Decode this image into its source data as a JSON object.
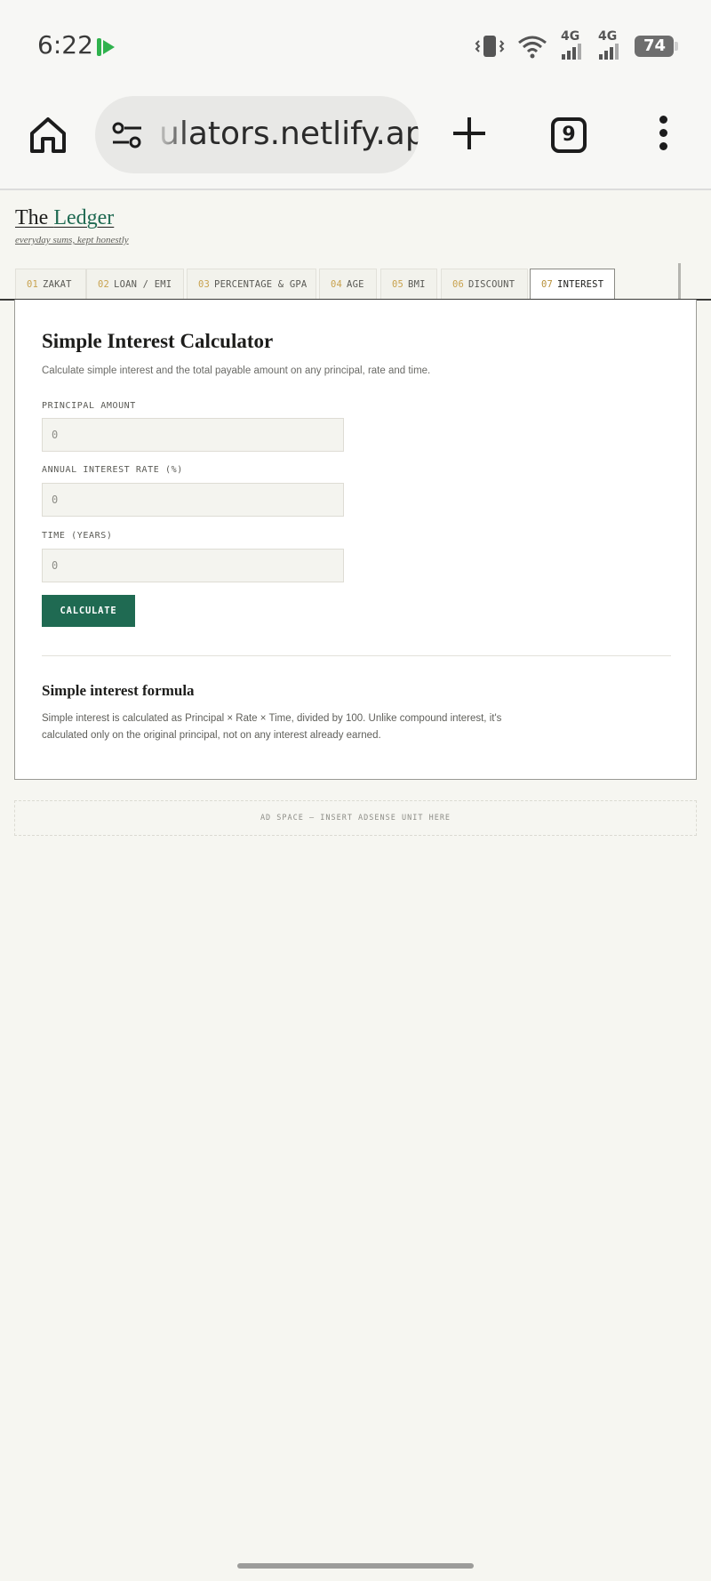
{
  "status": {
    "time": "6:22",
    "net1": "4G",
    "net2": "4G",
    "battery": "74"
  },
  "browser": {
    "url": "ulators.netlify.app",
    "tab_count": "9"
  },
  "site": {
    "brand_prefix": "The ",
    "brand_accent": "Ledger",
    "tagline": "everyday sums, kept honestly"
  },
  "tabs": [
    {
      "num": "01",
      "label": "ZAKAT"
    },
    {
      "num": "02",
      "label": "LOAN / EMI"
    },
    {
      "num": "03",
      "label": "PERCENTAGE & GPA"
    },
    {
      "num": "04",
      "label": "AGE"
    },
    {
      "num": "05",
      "label": "BMI"
    },
    {
      "num": "06",
      "label": "DISCOUNT"
    },
    {
      "num": "07",
      "label": "INTEREST"
    }
  ],
  "calculator": {
    "title": "Simple Interest Calculator",
    "description": "Calculate simple interest and the total payable amount on any principal, rate and time.",
    "principal_label": "PRINCIPAL AMOUNT",
    "principal_placeholder": "0",
    "rate_label": "ANNUAL INTEREST RATE (%)",
    "rate_placeholder": "0",
    "time_label": "TIME (YEARS)",
    "time_placeholder": "0",
    "button_label": "CALCULATE"
  },
  "formula": {
    "title": "Simple interest formula",
    "text": "Simple interest is calculated as Principal × Rate × Time, divided by 100. Unlike compound interest, it's calculated only on the original principal, not on any interest already earned."
  },
  "ad": {
    "text": "AD SPACE — INSERT ADSENSE UNIT HERE"
  },
  "colors": {
    "accent": "#1f6a52",
    "tab_number": "#c8a24e",
    "page_background": "#f6f6f1"
  },
  "icons": [
    "home-icon",
    "tune-icon",
    "plus-icon",
    "tab-switcher-icon",
    "more-vert-icon",
    "vibrate-icon",
    "wifi-icon",
    "signal-icon",
    "battery-icon"
  ]
}
